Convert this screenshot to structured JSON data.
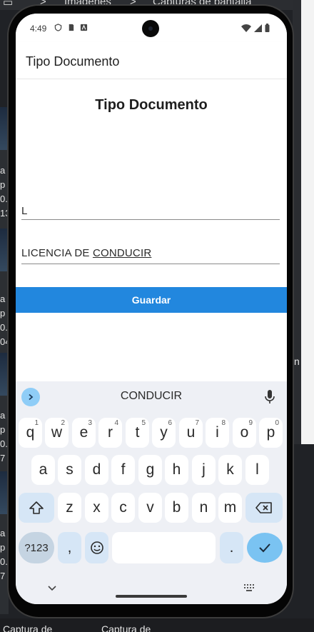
{
  "desktop": {
    "top_items": [
      "",
      ">",
      "Imágenes",
      ">",
      "Capturas de pantalla"
    ],
    "left_snippets": [
      "a",
      "p",
      "0.",
      "13",
      "a",
      "p",
      "0.",
      "04",
      "a",
      "p",
      "0.",
      "7",
      "a",
      "p",
      "0.",
      "7"
    ],
    "right_text": "n",
    "bottom_items": [
      "Captura de",
      "Captura de"
    ]
  },
  "status_bar": {
    "time": "4:49"
  },
  "app_bar": {
    "title": "Tipo Documento"
  },
  "form": {
    "heading": "Tipo Documento",
    "code_field_value": "L",
    "name_field_value": "LICENCIA DE CONDUCIR",
    "name_field_prefix": "LICENCIA DE ",
    "name_field_underlined": "CONDUCIR",
    "save_label": "Guardar"
  },
  "keyboard": {
    "suggestion": "CONDUCIR",
    "row1": [
      {
        "key": "q",
        "hint": "1"
      },
      {
        "key": "w",
        "hint": "2"
      },
      {
        "key": "e",
        "hint": "3"
      },
      {
        "key": "r",
        "hint": "4"
      },
      {
        "key": "t",
        "hint": "5"
      },
      {
        "key": "y",
        "hint": "6"
      },
      {
        "key": "u",
        "hint": "7"
      },
      {
        "key": "i",
        "hint": "8"
      },
      {
        "key": "o",
        "hint": "9"
      },
      {
        "key": "p",
        "hint": "0"
      }
    ],
    "row2": [
      "a",
      "s",
      "d",
      "f",
      "g",
      "h",
      "j",
      "k",
      "l"
    ],
    "row3": [
      "z",
      "x",
      "c",
      "v",
      "b",
      "n",
      "m"
    ],
    "symbols_label": "?123",
    "comma_label": ",",
    "period_label": ".",
    "space_label": ""
  },
  "icons": {
    "expand": "chevron-right-icon",
    "mic": "mic-icon",
    "shift": "shift-icon",
    "backspace": "backspace-icon",
    "emoji": "emoji-icon",
    "done": "check-icon",
    "hide": "chevron-down-icon",
    "layout": "keyboard-icon"
  },
  "colors": {
    "accent": "#2287de",
    "key_bg": "#ffffff",
    "keyboard_bg": "#eef0f5",
    "done_key": "#7ac3f2"
  }
}
